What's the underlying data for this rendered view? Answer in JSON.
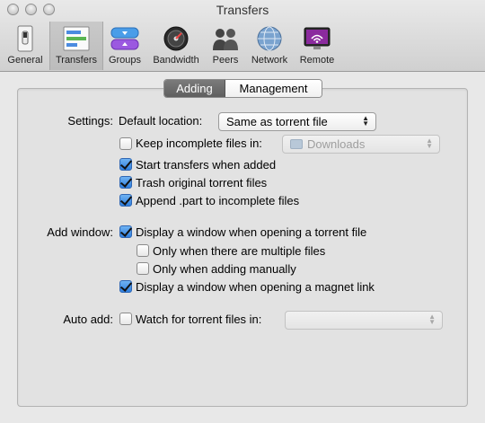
{
  "window": {
    "title": "Transfers"
  },
  "toolbar": {
    "items": [
      {
        "label": "General",
        "icon": "switch-icon"
      },
      {
        "label": "Transfers",
        "icon": "transfers-icon",
        "selected": true
      },
      {
        "label": "Groups",
        "icon": "groups-icon"
      },
      {
        "label": "Bandwidth",
        "icon": "speedometer-icon"
      },
      {
        "label": "Peers",
        "icon": "people-icon"
      },
      {
        "label": "Network",
        "icon": "globe-icon"
      },
      {
        "label": "Remote",
        "icon": "remote-display-icon"
      }
    ]
  },
  "tabs": {
    "adding": "Adding",
    "management": "Management",
    "selected": "Adding"
  },
  "settings": {
    "label": "Settings:",
    "default_location_label": "Default location:",
    "default_location_value": "Same as torrent file",
    "keep_incomplete_label": "Keep incomplete files in:",
    "keep_incomplete_checked": false,
    "keep_incomplete_folder": "Downloads",
    "start_transfers_label": "Start transfers when added",
    "start_transfers_checked": true,
    "trash_original_label": "Trash original torrent files",
    "trash_original_checked": true,
    "append_part_label": "Append .part to incomplete files",
    "append_part_checked": true
  },
  "add_window": {
    "label": "Add window:",
    "display_torrent_label": "Display a window when opening a torrent file",
    "display_torrent_checked": true,
    "multiple_files_label": "Only when there are multiple files",
    "multiple_files_checked": false,
    "adding_manually_label": "Only when adding manually",
    "adding_manually_checked": false,
    "display_magnet_label": "Display a window when opening a magnet link",
    "display_magnet_checked": true
  },
  "auto_add": {
    "label": "Auto add:",
    "watch_label": "Watch for torrent files in:",
    "watch_checked": false,
    "watch_folder": ""
  }
}
